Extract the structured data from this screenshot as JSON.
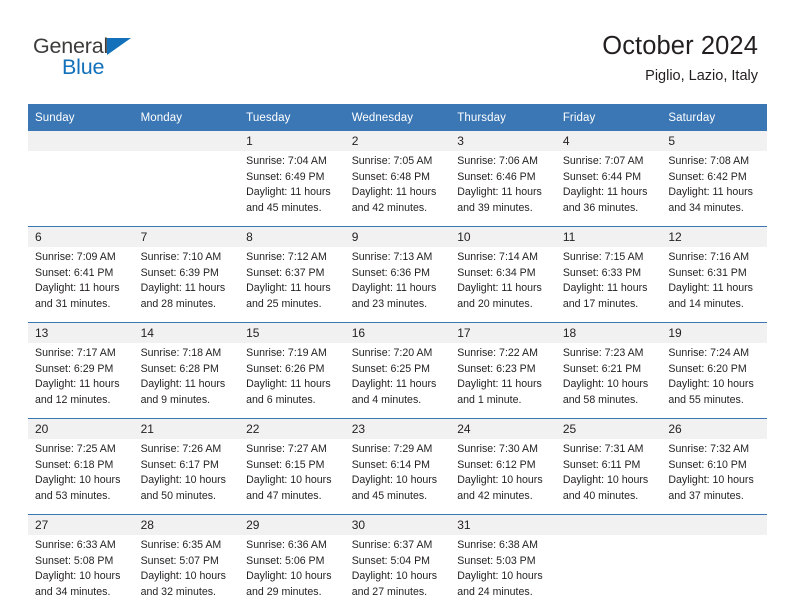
{
  "brand": {
    "name_part1": "General",
    "name_part2": "Blue",
    "triangle_color": "#1271ba"
  },
  "header": {
    "title": "October 2024",
    "subtitle": "Piglio, Lazio, Italy",
    "accent_color": "#3b77b5",
    "daynum_band_color": "#f1f1f1"
  },
  "weekdays": [
    "Sunday",
    "Monday",
    "Tuesday",
    "Wednesday",
    "Thursday",
    "Friday",
    "Saturday"
  ],
  "weeks": [
    {
      "days": [
        {
          "num": "",
          "sunrise": "",
          "sunset": "",
          "daylight_1": "",
          "daylight_2": ""
        },
        {
          "num": "",
          "sunrise": "",
          "sunset": "",
          "daylight_1": "",
          "daylight_2": ""
        },
        {
          "num": "1",
          "sunrise": "Sunrise: 7:04 AM",
          "sunset": "Sunset: 6:49 PM",
          "daylight_1": "Daylight: 11 hours",
          "daylight_2": "and 45 minutes."
        },
        {
          "num": "2",
          "sunrise": "Sunrise: 7:05 AM",
          "sunset": "Sunset: 6:48 PM",
          "daylight_1": "Daylight: 11 hours",
          "daylight_2": "and 42 minutes."
        },
        {
          "num": "3",
          "sunrise": "Sunrise: 7:06 AM",
          "sunset": "Sunset: 6:46 PM",
          "daylight_1": "Daylight: 11 hours",
          "daylight_2": "and 39 minutes."
        },
        {
          "num": "4",
          "sunrise": "Sunrise: 7:07 AM",
          "sunset": "Sunset: 6:44 PM",
          "daylight_1": "Daylight: 11 hours",
          "daylight_2": "and 36 minutes."
        },
        {
          "num": "5",
          "sunrise": "Sunrise: 7:08 AM",
          "sunset": "Sunset: 6:42 PM",
          "daylight_1": "Daylight: 11 hours",
          "daylight_2": "and 34 minutes."
        }
      ]
    },
    {
      "days": [
        {
          "num": "6",
          "sunrise": "Sunrise: 7:09 AM",
          "sunset": "Sunset: 6:41 PM",
          "daylight_1": "Daylight: 11 hours",
          "daylight_2": "and 31 minutes."
        },
        {
          "num": "7",
          "sunrise": "Sunrise: 7:10 AM",
          "sunset": "Sunset: 6:39 PM",
          "daylight_1": "Daylight: 11 hours",
          "daylight_2": "and 28 minutes."
        },
        {
          "num": "8",
          "sunrise": "Sunrise: 7:12 AM",
          "sunset": "Sunset: 6:37 PM",
          "daylight_1": "Daylight: 11 hours",
          "daylight_2": "and 25 minutes."
        },
        {
          "num": "9",
          "sunrise": "Sunrise: 7:13 AM",
          "sunset": "Sunset: 6:36 PM",
          "daylight_1": "Daylight: 11 hours",
          "daylight_2": "and 23 minutes."
        },
        {
          "num": "10",
          "sunrise": "Sunrise: 7:14 AM",
          "sunset": "Sunset: 6:34 PM",
          "daylight_1": "Daylight: 11 hours",
          "daylight_2": "and 20 minutes."
        },
        {
          "num": "11",
          "sunrise": "Sunrise: 7:15 AM",
          "sunset": "Sunset: 6:33 PM",
          "daylight_1": "Daylight: 11 hours",
          "daylight_2": "and 17 minutes."
        },
        {
          "num": "12",
          "sunrise": "Sunrise: 7:16 AM",
          "sunset": "Sunset: 6:31 PM",
          "daylight_1": "Daylight: 11 hours",
          "daylight_2": "and 14 minutes."
        }
      ]
    },
    {
      "days": [
        {
          "num": "13",
          "sunrise": "Sunrise: 7:17 AM",
          "sunset": "Sunset: 6:29 PM",
          "daylight_1": "Daylight: 11 hours",
          "daylight_2": "and 12 minutes."
        },
        {
          "num": "14",
          "sunrise": "Sunrise: 7:18 AM",
          "sunset": "Sunset: 6:28 PM",
          "daylight_1": "Daylight: 11 hours",
          "daylight_2": "and 9 minutes."
        },
        {
          "num": "15",
          "sunrise": "Sunrise: 7:19 AM",
          "sunset": "Sunset: 6:26 PM",
          "daylight_1": "Daylight: 11 hours",
          "daylight_2": "and 6 minutes."
        },
        {
          "num": "16",
          "sunrise": "Sunrise: 7:20 AM",
          "sunset": "Sunset: 6:25 PM",
          "daylight_1": "Daylight: 11 hours",
          "daylight_2": "and 4 minutes."
        },
        {
          "num": "17",
          "sunrise": "Sunrise: 7:22 AM",
          "sunset": "Sunset: 6:23 PM",
          "daylight_1": "Daylight: 11 hours",
          "daylight_2": "and 1 minute."
        },
        {
          "num": "18",
          "sunrise": "Sunrise: 7:23 AM",
          "sunset": "Sunset: 6:21 PM",
          "daylight_1": "Daylight: 10 hours",
          "daylight_2": "and 58 minutes."
        },
        {
          "num": "19",
          "sunrise": "Sunrise: 7:24 AM",
          "sunset": "Sunset: 6:20 PM",
          "daylight_1": "Daylight: 10 hours",
          "daylight_2": "and 55 minutes."
        }
      ]
    },
    {
      "days": [
        {
          "num": "20",
          "sunrise": "Sunrise: 7:25 AM",
          "sunset": "Sunset: 6:18 PM",
          "daylight_1": "Daylight: 10 hours",
          "daylight_2": "and 53 minutes."
        },
        {
          "num": "21",
          "sunrise": "Sunrise: 7:26 AM",
          "sunset": "Sunset: 6:17 PM",
          "daylight_1": "Daylight: 10 hours",
          "daylight_2": "and 50 minutes."
        },
        {
          "num": "22",
          "sunrise": "Sunrise: 7:27 AM",
          "sunset": "Sunset: 6:15 PM",
          "daylight_1": "Daylight: 10 hours",
          "daylight_2": "and 47 minutes."
        },
        {
          "num": "23",
          "sunrise": "Sunrise: 7:29 AM",
          "sunset": "Sunset: 6:14 PM",
          "daylight_1": "Daylight: 10 hours",
          "daylight_2": "and 45 minutes."
        },
        {
          "num": "24",
          "sunrise": "Sunrise: 7:30 AM",
          "sunset": "Sunset: 6:12 PM",
          "daylight_1": "Daylight: 10 hours",
          "daylight_2": "and 42 minutes."
        },
        {
          "num": "25",
          "sunrise": "Sunrise: 7:31 AM",
          "sunset": "Sunset: 6:11 PM",
          "daylight_1": "Daylight: 10 hours",
          "daylight_2": "and 40 minutes."
        },
        {
          "num": "26",
          "sunrise": "Sunrise: 7:32 AM",
          "sunset": "Sunset: 6:10 PM",
          "daylight_1": "Daylight: 10 hours",
          "daylight_2": "and 37 minutes."
        }
      ]
    },
    {
      "days": [
        {
          "num": "27",
          "sunrise": "Sunrise: 6:33 AM",
          "sunset": "Sunset: 5:08 PM",
          "daylight_1": "Daylight: 10 hours",
          "daylight_2": "and 34 minutes."
        },
        {
          "num": "28",
          "sunrise": "Sunrise: 6:35 AM",
          "sunset": "Sunset: 5:07 PM",
          "daylight_1": "Daylight: 10 hours",
          "daylight_2": "and 32 minutes."
        },
        {
          "num": "29",
          "sunrise": "Sunrise: 6:36 AM",
          "sunset": "Sunset: 5:06 PM",
          "daylight_1": "Daylight: 10 hours",
          "daylight_2": "and 29 minutes."
        },
        {
          "num": "30",
          "sunrise": "Sunrise: 6:37 AM",
          "sunset": "Sunset: 5:04 PM",
          "daylight_1": "Daylight: 10 hours",
          "daylight_2": "and 27 minutes."
        },
        {
          "num": "31",
          "sunrise": "Sunrise: 6:38 AM",
          "sunset": "Sunset: 5:03 PM",
          "daylight_1": "Daylight: 10 hours",
          "daylight_2": "and 24 minutes."
        },
        {
          "num": "",
          "sunrise": "",
          "sunset": "",
          "daylight_1": "",
          "daylight_2": ""
        },
        {
          "num": "",
          "sunrise": "",
          "sunset": "",
          "daylight_1": "",
          "daylight_2": ""
        }
      ]
    }
  ]
}
